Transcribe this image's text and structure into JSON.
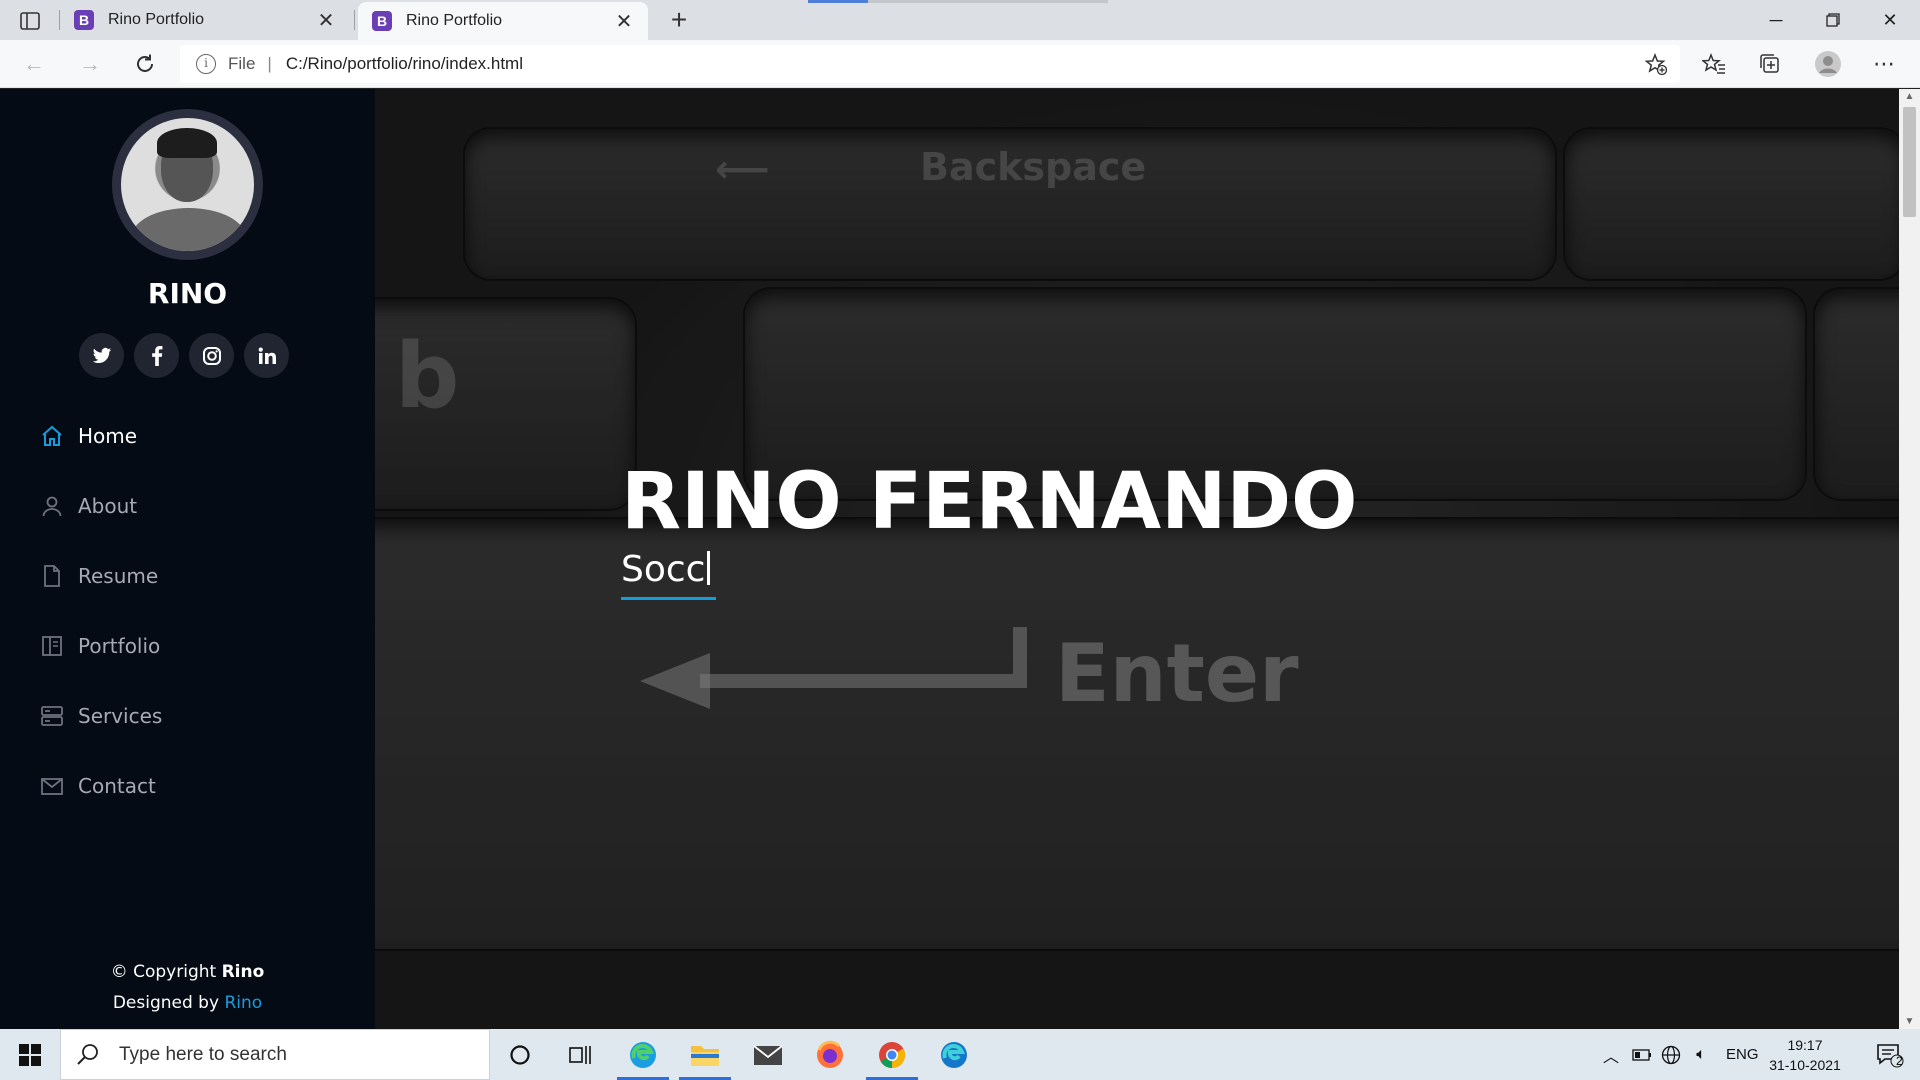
{
  "browser": {
    "tabs": [
      {
        "title": "Rino Portfolio",
        "favicon_letter": "B",
        "active": false
      },
      {
        "title": "Rino Portfolio",
        "favicon_letter": "B",
        "active": true
      }
    ],
    "address": {
      "scheme_label": "File",
      "url": "C:/Rino/portfolio/rino/index.html"
    }
  },
  "sidebar": {
    "name": "RINO",
    "socials": [
      {
        "icon": "twitter-icon",
        "glyph": "𝕏"
      },
      {
        "icon": "facebook-icon",
        "glyph": "f"
      },
      {
        "icon": "instagram-icon",
        "glyph": "◎"
      },
      {
        "icon": "linkedin-icon",
        "glyph": "in"
      }
    ],
    "nav": [
      {
        "label": "Home",
        "icon": "home-icon",
        "active": true
      },
      {
        "label": "About",
        "icon": "user-icon",
        "active": false
      },
      {
        "label": "Resume",
        "icon": "file-icon",
        "active": false
      },
      {
        "label": "Portfolio",
        "icon": "book-icon",
        "active": false
      },
      {
        "label": "Services",
        "icon": "server-icon",
        "active": false
      },
      {
        "label": "Contact",
        "icon": "envelope-icon",
        "active": false
      }
    ],
    "footer": {
      "copyright_prefix": "© Copyright",
      "copyright_name": "Rino",
      "designed_prefix": "Designed by",
      "designed_name": "Rino"
    }
  },
  "hero": {
    "title": "RINO FERNANDO",
    "typed_text": "Socc",
    "key_labels": {
      "backspace": "Backspace",
      "enter": "Enter",
      "b": "b"
    }
  },
  "taskbar": {
    "search_placeholder": "Type here to search",
    "language": "ENG",
    "time": "19:17",
    "date": "31-10-2021",
    "notification_count": "2"
  },
  "colors": {
    "accent": "#149ddd",
    "sidebar_bg": "#040b14",
    "social_bg": "#212431"
  }
}
